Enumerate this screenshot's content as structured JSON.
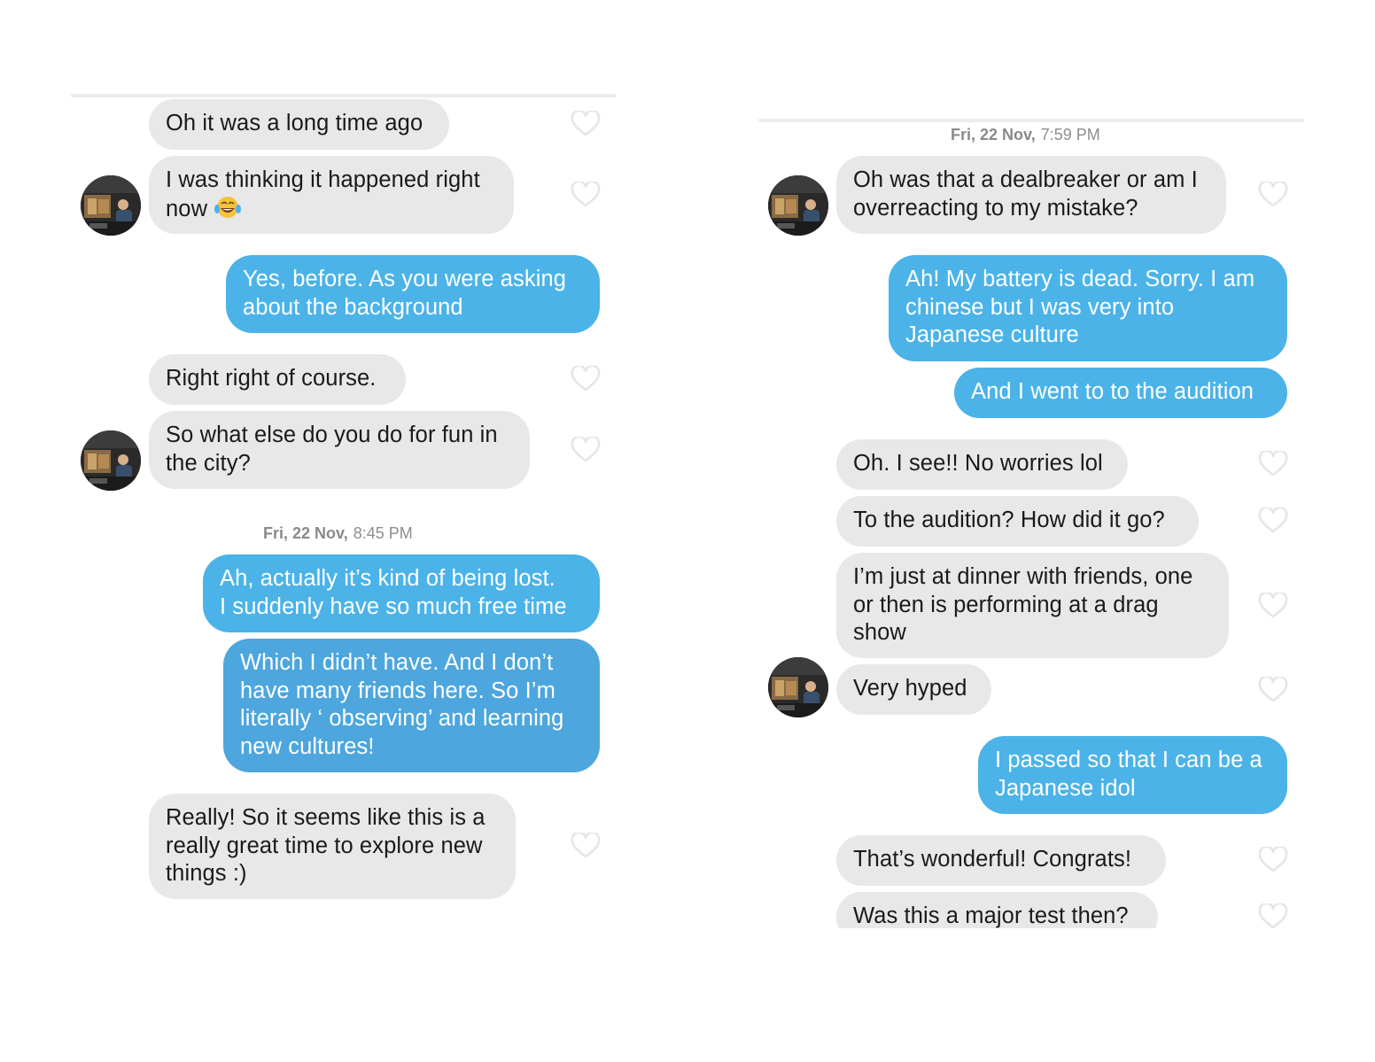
{
  "left": {
    "messages": [
      {
        "text": [
          "Oh it was a long time ago"
        ]
      },
      {
        "text": [
          "I was thinking it happened right",
          "now"
        ],
        "emoji": "tears-of-joy"
      },
      {
        "text": [
          "Yes, before. As you were asking",
          "about the background"
        ]
      },
      {
        "text": [
          "Right right of course."
        ]
      },
      {
        "text": [
          "So what else do you do for fun in",
          "the city?"
        ]
      },
      {
        "text": [
          "Ah, actually it’s kind of being lost.",
          "I suddenly have so much free time"
        ]
      },
      {
        "text": [
          "Which I didn’t have. And I don’t",
          "have many friends here. So I’m",
          "literally ‘ observing’ and learning",
          "new cultures!"
        ]
      },
      {
        "text": [
          "Really! So it seems like this is a",
          "really great time to explore new",
          "things :)"
        ]
      }
    ],
    "timestamp": {
      "date": "Fri, 22 Nov,",
      "time": "8:45 PM"
    }
  },
  "right": {
    "timestamp": {
      "date": "Fri, 22 Nov,",
      "time": "7:59 PM"
    },
    "messages": [
      {
        "text": [
          "Oh was that a dealbreaker or am I",
          "overreacting to my mistake?"
        ]
      },
      {
        "text": [
          "Ah! My battery is dead. Sorry. I am",
          "chinese but I was very into",
          "Japanese culture"
        ]
      },
      {
        "text": [
          "And I went to to the audition"
        ]
      },
      {
        "text": [
          "Oh. I see!! No worries lol"
        ]
      },
      {
        "text": [
          "To the audition? How did it go?"
        ]
      },
      {
        "text": [
          "I’m just at dinner with friends, one",
          "or then is performing at a drag",
          "show"
        ]
      },
      {
        "text": [
          "Very hyped"
        ]
      },
      {
        "text": [
          "I passed so that I can be a",
          "Japanese idol"
        ]
      },
      {
        "text": [
          "That’s wonderful! Congrats!"
        ]
      },
      {
        "text": [
          "Was this a major test then?"
        ]
      }
    ]
  },
  "colors": {
    "incoming_bubble": "#e8e8e8",
    "outgoing_bubble": "#4bb3e8",
    "heart_outline": "#e6e6e6",
    "timestamp_text": "#8e8e8e"
  },
  "icons": {
    "like": "heart-outline-icon",
    "avatar": "match-avatar",
    "emoji": "tears-of-joy-emoji"
  }
}
